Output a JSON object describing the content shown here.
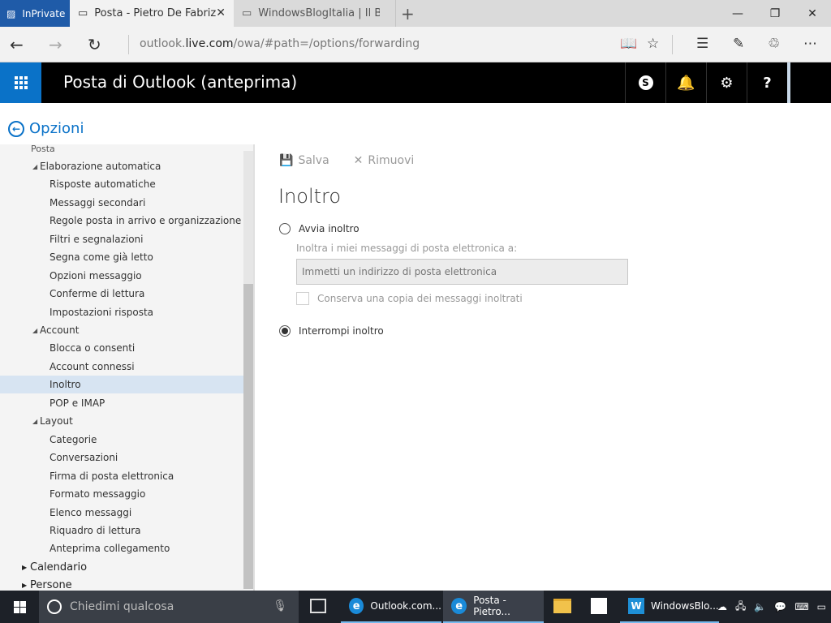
{
  "browser": {
    "inprivate_label": "InPrivate",
    "active_tab_title": "Posta - Pietro De Fabrizi",
    "inactive_tab_title": "WindowsBlogItalia | Il Blog su",
    "url_prefix": "outlook.",
    "url_domain": "live.com",
    "url_path": "/owa/#path=/options/forwarding"
  },
  "header": {
    "app_title": "Posta di Outlook (anteprima)",
    "help_label": "?"
  },
  "back_label": "Opzioni",
  "nav": {
    "cut_item": "Posta",
    "sections": [
      {
        "label": "Elaborazione automatica",
        "items": [
          "Risposte automatiche",
          "Messaggi secondari",
          "Regole posta in arrivo e organizzazione",
          "Filtri e segnalazioni",
          "Segna come già letto",
          "Opzioni messaggio",
          "Conferme di lettura",
          "Impostazioni risposta"
        ]
      },
      {
        "label": "Account",
        "items": [
          "Blocca o consenti",
          "Account connessi",
          "Inoltro",
          "POP e IMAP"
        ]
      },
      {
        "label": "Layout",
        "items": [
          "Categorie",
          "Conversazioni",
          "Firma di posta elettronica",
          "Formato messaggio",
          "Elenco messaggi",
          "Riquadro di lettura",
          "Anteprima collegamento"
        ]
      }
    ],
    "top_items": [
      "Calendario",
      "Persone"
    ],
    "selected": "Inoltro"
  },
  "toolbar": {
    "save_label": "Salva",
    "remove_label": "Rimuovi"
  },
  "page": {
    "title": "Inoltro",
    "start_forwarding_label": "Avvia inoltro",
    "forward_to_label": "Inoltra i miei messaggi di posta elettronica a:",
    "email_placeholder": "Immetti un indirizzo di posta elettronica",
    "keep_copy_label": "Conserva una copia dei messaggi inoltrati",
    "stop_forwarding_label": "Interrompi inoltro",
    "selected_option": "Interrompi inoltro"
  },
  "taskbar": {
    "search_placeholder": "Chiedimi qualcosa",
    "apps": [
      "Outlook.com...",
      "Posta - Pietro...",
      "WindowsBlo..."
    ]
  },
  "colors": {
    "accent": "#0a72c8",
    "header_bg": "#000000",
    "selected_nav": "#d7e4f2"
  }
}
